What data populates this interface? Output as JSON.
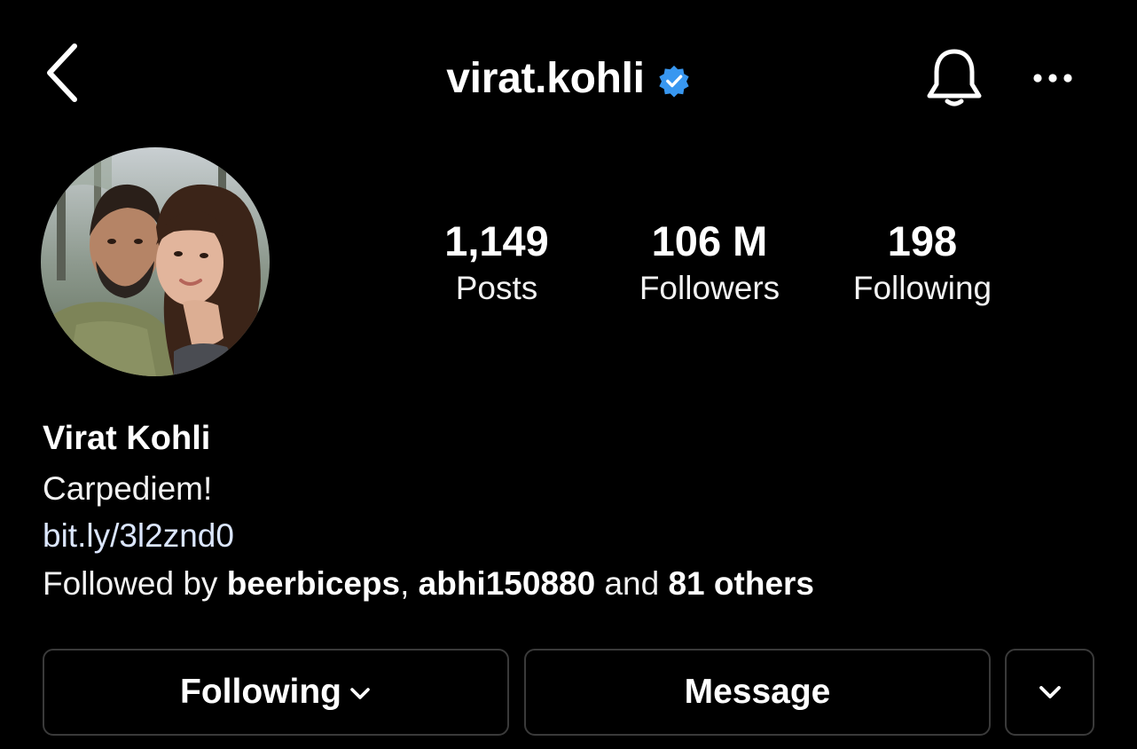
{
  "header": {
    "username": "virat.kohli",
    "verified": true,
    "icons": {
      "back": "chevron-left-icon",
      "verified": "verified-badge-icon",
      "notifications": "bell-icon",
      "more": "more-horizontal-icon"
    }
  },
  "profile": {
    "avatar": "profile-photo",
    "stats": {
      "posts": {
        "value": "1,149",
        "label": "Posts"
      },
      "followers": {
        "value": "106 M",
        "label": "Followers"
      },
      "following": {
        "value": "198",
        "label": "Following"
      }
    },
    "display_name": "Virat Kohli",
    "bio": "Carpediem!",
    "link": "bit.ly/3l2znd0",
    "followed_by": {
      "prefix": "Followed by ",
      "user1": "beerbiceps",
      "separator": ", ",
      "user2": "abhi150880",
      "conjunction": " and ",
      "others": "81 others"
    }
  },
  "actions": {
    "following_label": "Following",
    "message_label": "Message"
  },
  "colors": {
    "background": "#000000",
    "text": "#ffffff",
    "verified_blue": "#3897f0",
    "link": "#dbe6ff",
    "button_border": "#3a3a3a"
  }
}
